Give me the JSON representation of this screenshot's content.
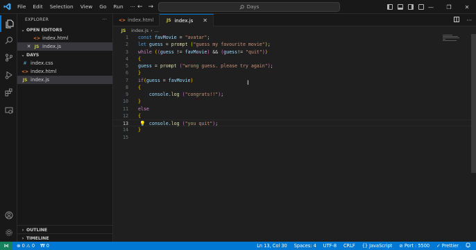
{
  "titlebar": {
    "menu": [
      "File",
      "Edit",
      "Selection",
      "View",
      "Go",
      "Run",
      "···"
    ],
    "search_text": "Days",
    "window_controls": [
      "—",
      "❐",
      "✕"
    ]
  },
  "sidebar": {
    "title": "EXPLORER",
    "more": "···",
    "open_editors_label": "OPEN EDITORS",
    "open_editors": [
      {
        "name": "index.html",
        "icon": "html"
      },
      {
        "name": "index.js",
        "icon": "js"
      }
    ],
    "folder_label": "DAYS",
    "files": [
      {
        "name": "index.css",
        "icon": "css"
      },
      {
        "name": "index.html",
        "icon": "html"
      },
      {
        "name": "index.js",
        "icon": "js"
      }
    ],
    "outline_label": "OUTLINE",
    "timeline_label": "TIMELINE"
  },
  "tabs": [
    {
      "name": "index.html",
      "icon": "html"
    },
    {
      "name": "index.js",
      "icon": "js"
    }
  ],
  "breadcrumbs": {
    "file": "index.js",
    "rest": "..."
  },
  "code_lines": [
    {
      "n": "1",
      "html": "<span class=\"kw\">const</span> <span class=\"var\">favMovie</span> <span class=\"pun\">=</span> <span class=\"str\">\"avatar\"</span><span class=\"pun\">;</span>"
    },
    {
      "n": "2",
      "html": "<span class=\"kw\">let</span> <span class=\"var\">guess</span> <span class=\"pun\">=</span> <span class=\"fn\">prompt</span> <span class=\"br1\">(</span><span class=\"str\">\"guess my favourite movie\"</span><span class=\"br1\">)</span><span class=\"pun\">;</span>"
    },
    {
      "n": "3",
      "html": "<span class=\"ctrl\">while</span> <span class=\"br1\">(</span><span class=\"br2\">(</span><span class=\"var\">guess</span> <span class=\"pun\">!=</span> <span class=\"var\">favMovie</span><span class=\"br2\">)</span> <span class=\"pun\">&amp;&amp;</span> <span class=\"br2\">(</span><span class=\"var\">guess</span><span class=\"pun\">!=</span> <span class=\"str\">\"quit\"</span><span class=\"br2\">)</span><span class=\"br1\">)</span>"
    },
    {
      "n": "4",
      "html": "<span class=\"br1\">{</span>"
    },
    {
      "n": "5",
      "html": "<span class=\"var\">guess</span> <span class=\"pun\">=</span> <span class=\"fn\">prompt</span> <span class=\"br2\">(</span><span class=\"str\">\"wrong guess. please try again\"</span><span class=\"br2\">)</span><span class=\"pun\">;</span>"
    },
    {
      "n": "6",
      "html": "<span class=\"br1\">}</span>"
    },
    {
      "n": "7",
      "html": "<span class=\"ctrl\">if</span><span class=\"br1\">(</span><span class=\"var\">guess</span> <span class=\"pun\">=</span> <span class=\"var\">favMovie</span><span class=\"br1\">)</span>"
    },
    {
      "n": "8",
      "html": "<span class=\"br1\">{</span>"
    },
    {
      "n": "9",
      "html": "    <span class=\"var\">console</span><span class=\"pun\">.</span><span class=\"fn\">log</span> <span class=\"br2\">(</span><span class=\"str\">\"congrats!!\"</span><span class=\"br2\">)</span><span class=\"pun\">;</span>"
    },
    {
      "n": "10",
      "html": "<span class=\"br1\">}</span>"
    },
    {
      "n": "11",
      "html": "<span class=\"ctrl\">else</span>"
    },
    {
      "n": "12",
      "html": "<span class=\"br1\">{</span>"
    },
    {
      "n": "13",
      "html": "    <span class=\"var\">console</span><span class=\"pun\">.</span><span class=\"fn\">log</span> <span class=\"br2\">(</span><span class=\"str\">\"you quit\"</span><span class=\"br2\">)</span><span class=\"pun\">;</span>"
    },
    {
      "n": "14",
      "html": "<span class=\"br1\">}</span>"
    },
    {
      "n": "15",
      "html": ""
    }
  ],
  "current_line": "13",
  "statusbar": {
    "remote_icon": "⋈",
    "problems": "⊗ 0 ⚠ 0",
    "ports": "₩ 0",
    "position": "Ln 13, Col 30",
    "spaces": "Spaces: 4",
    "encoding": "UTF-8",
    "eol": "CRLF",
    "language": "{} JavaScript",
    "port": "⊘ Port : 5500",
    "prettier": "✓ Prettier",
    "bell": "🔔"
  },
  "colors": {
    "accent": "#0078d4",
    "remote": "#16825d",
    "background": "#1f1f1f",
    "sidebar": "#181818"
  }
}
